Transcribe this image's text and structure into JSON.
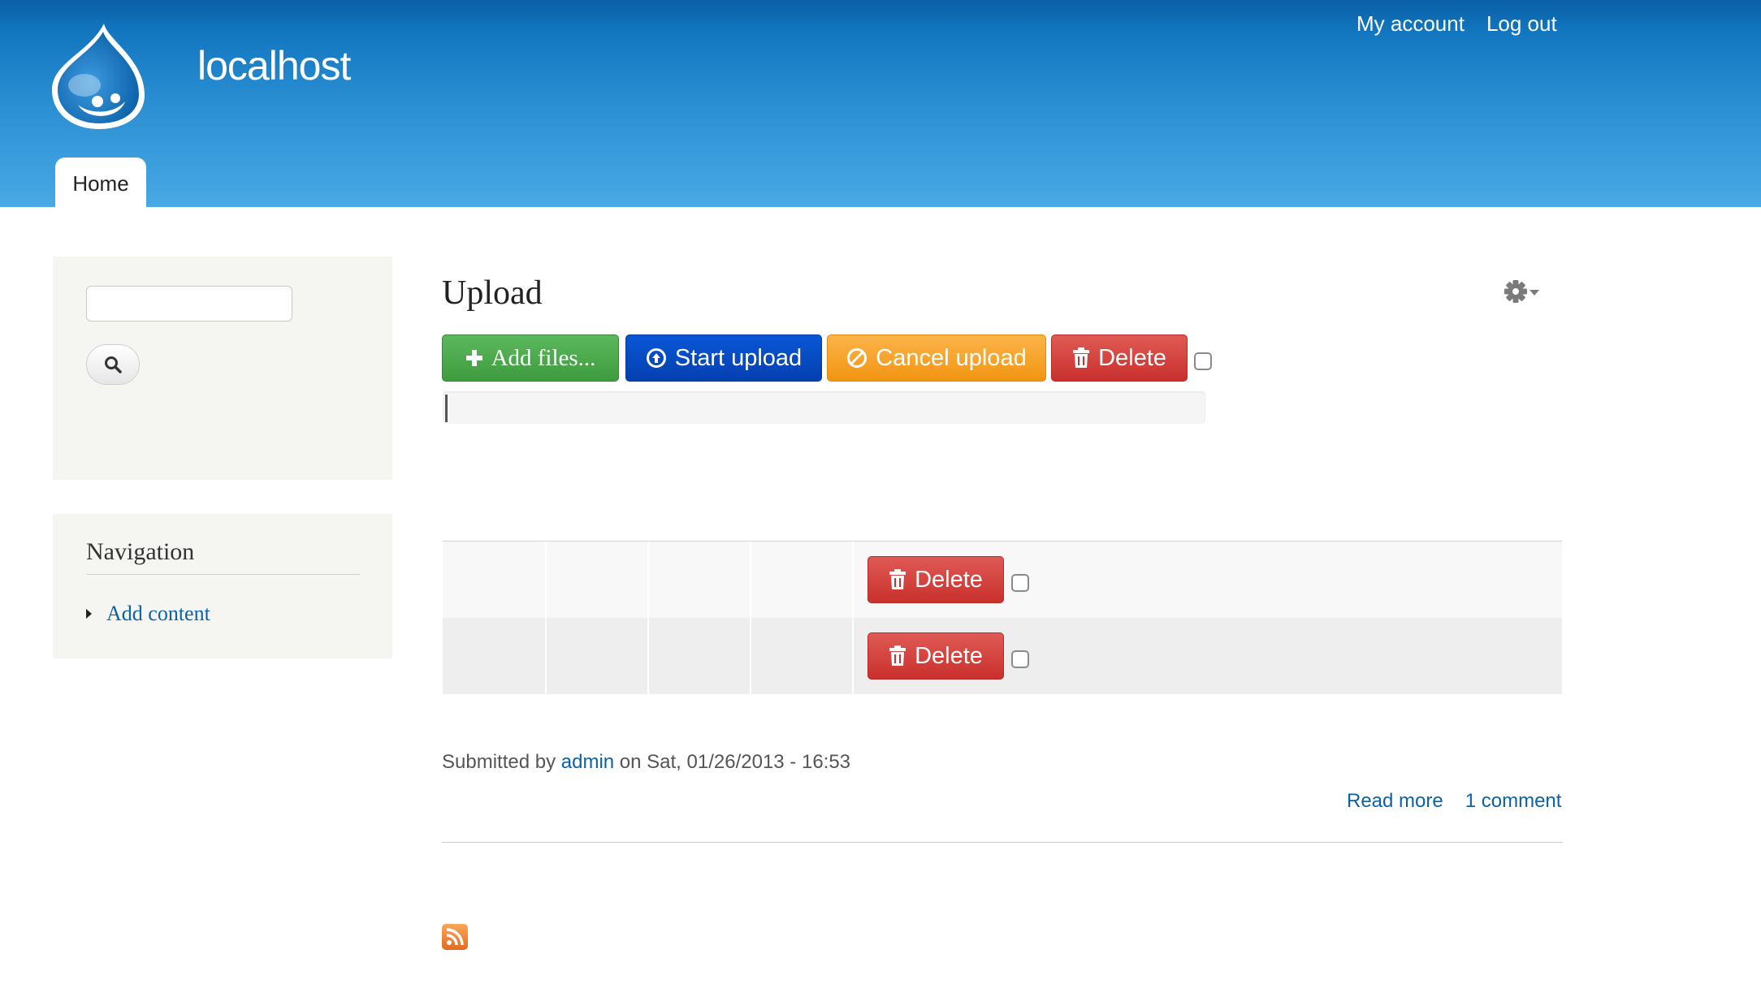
{
  "site": {
    "name": "localhost"
  },
  "secondary_menu": [
    {
      "label": "My account"
    },
    {
      "label": "Log out"
    }
  ],
  "main_menu": {
    "home": "Home"
  },
  "sidebar": {
    "search": {
      "placeholder": ""
    },
    "navigation": {
      "title": "Navigation",
      "items": [
        {
          "label": "Add content"
        }
      ]
    }
  },
  "node": {
    "title": "Upload",
    "toolbar": {
      "add_files": "Add files...",
      "start_upload": "Start upload",
      "cancel_upload": "Cancel upload",
      "delete": "Delete"
    },
    "progress_percent": 0,
    "files": [
      {
        "delete_label": "Delete"
      },
      {
        "delete_label": "Delete"
      }
    ],
    "submitted": {
      "prefix": "Submitted by",
      "author": "admin",
      "suffix": "on Sat, 01/26/2013 - 16:53"
    },
    "links": {
      "read_more": "Read more",
      "comments": "1 comment"
    }
  },
  "colors": {
    "header_top": "#0a5fa6",
    "header_bottom": "#48a9e4",
    "link": "#0b62a9",
    "add": "#4cae4c",
    "start": "#0a4fc8",
    "cancel": "#f6a42c",
    "delete": "#d9433f"
  },
  "icons": [
    "drupal-logo",
    "search-icon",
    "gear-icon",
    "plus-icon",
    "upload-icon",
    "ban-icon",
    "trash-icon",
    "rss-icon"
  ]
}
